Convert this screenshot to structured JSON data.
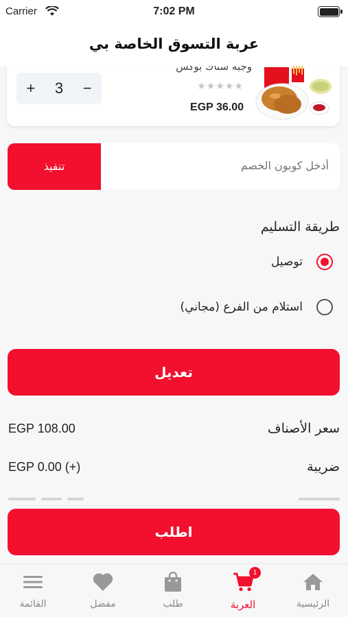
{
  "status_bar": {
    "carrier": "Carrier",
    "time": "7:02 PM"
  },
  "header": {
    "title": "عربة التسوق الخاصة بي"
  },
  "cart_item": {
    "name": "وجبة ستاك بوكس",
    "rating_stars": "★★★★★",
    "rating_value": 0,
    "price": "EGP 36.00",
    "quantity": "3",
    "plus": "+",
    "minus": "−"
  },
  "coupon": {
    "placeholder": "أدخل كوبون الخصم",
    "apply_label": "تنفيذ"
  },
  "delivery": {
    "title": "طريقة التسليم",
    "options": [
      {
        "label": "توصيل",
        "selected": true
      },
      {
        "label": "استلام من الفرع (مجاني)",
        "selected": false
      }
    ]
  },
  "edit_button": "تعديل",
  "summary": {
    "items_price_label": "سعر الأصناف",
    "items_price_value": "EGP 108.00",
    "tax_label": "ضريبة",
    "tax_value": "EGP 0.00 (+)"
  },
  "order_button": "اطلب",
  "tabs": [
    {
      "label": "القائمة",
      "icon": "menu-icon"
    },
    {
      "label": "مفضل",
      "icon": "heart-icon"
    },
    {
      "label": "طلب",
      "icon": "bag-icon"
    },
    {
      "label": "العربة",
      "icon": "cart-icon",
      "active": true,
      "badge": "1"
    },
    {
      "label": "الرئيسية",
      "icon": "home-icon"
    }
  ],
  "colors": {
    "accent": "#f2102e",
    "background": "#f7f7f7",
    "inactive": "#888888"
  }
}
